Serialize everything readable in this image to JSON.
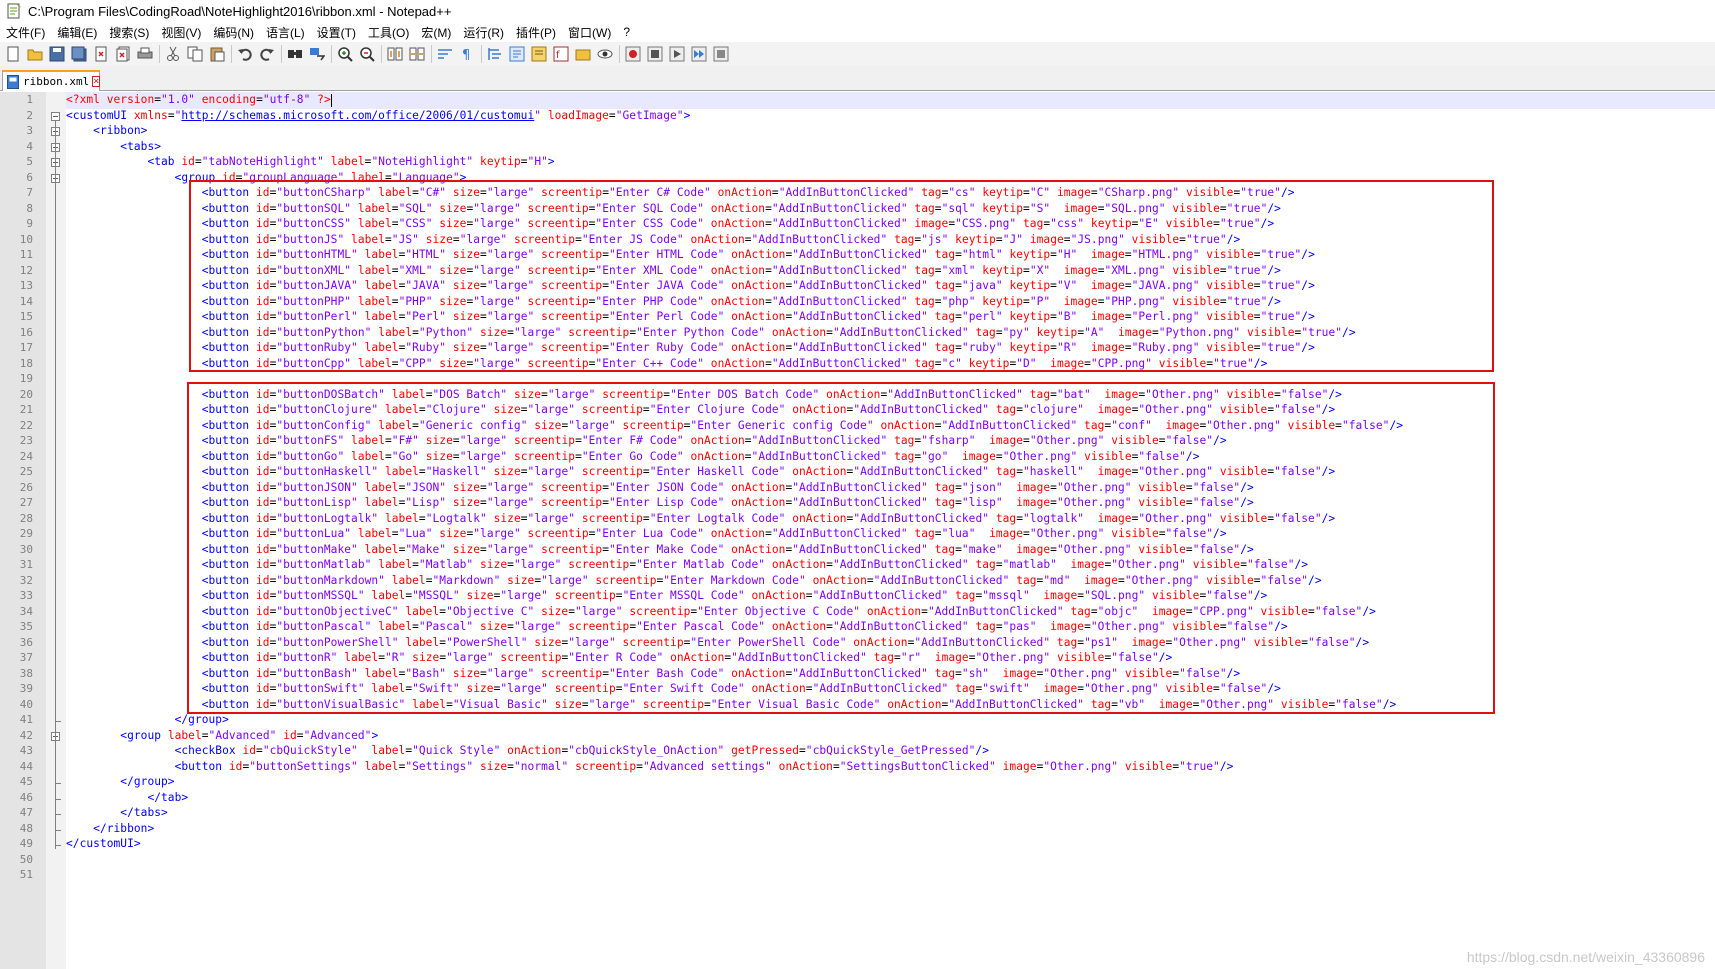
{
  "window": {
    "title": "C:\\Program Files\\CodingRoad\\NoteHighlight2016\\ribbon.xml - Notepad++"
  },
  "menu": [
    "文件(F)",
    "编辑(E)",
    "搜索(S)",
    "视图(V)",
    "编码(N)",
    "语言(L)",
    "设置(T)",
    "工具(O)",
    "宏(M)",
    "运行(R)",
    "插件(P)",
    "窗口(W)",
    "?"
  ],
  "toolbar_icons": [
    "new-file-icon",
    "open-file-icon",
    "save-icon",
    "save-all-icon",
    "close-icon",
    "close-all-icon",
    "print-icon",
    "|",
    "cut-icon",
    "copy-icon",
    "paste-icon",
    "|",
    "undo-icon",
    "redo-icon",
    "|",
    "find-icon",
    "replace-icon",
    "|",
    "zoom-in-icon",
    "zoom-out-icon",
    "|",
    "sync-vertical-icon",
    "sync-horizontal-icon",
    "|",
    "word-wrap-icon",
    "show-all-chars-icon",
    "|",
    "indent-guide-icon",
    "user-lang-icon",
    "doc-map-icon",
    "function-list-icon",
    "folder-workspace-icon",
    "monitor-icon",
    "|",
    "record-macro-icon",
    "stop-record-icon",
    "play-macro-icon",
    "play-multiple-icon",
    "save-macro-icon"
  ],
  "tab": {
    "label": "ribbon.xml"
  },
  "editor": {
    "line_numbers": [
      "1",
      "2",
      "3",
      "4",
      "5",
      "6",
      "7",
      "8",
      "9",
      "10",
      "11",
      "12",
      "13",
      "14",
      "15",
      "16",
      "17",
      "18",
      "19",
      "20",
      "21",
      "22",
      "23",
      "24",
      "25",
      "26",
      "27",
      "28",
      "29",
      "30",
      "31",
      "32",
      "33",
      "34",
      "35",
      "36",
      "37",
      "38",
      "39",
      "40",
      "41",
      "42",
      "43",
      "44",
      "45",
      "46",
      "47",
      "48",
      "49",
      "50",
      "51"
    ],
    "lines": [
      "<?xml version=\"1.0\" encoding=\"utf-8\" ?>",
      "<customUI xmlns=\"http://schemas.microsoft.com/office/2006/01/customui\" loadImage=\"GetImage\">",
      "    <ribbon>",
      "        <tabs>",
      "            <tab id=\"tabNoteHighlight\" label=\"NoteHighlight\" keytip=\"H\">",
      "                <group id=\"groupLanguage\" label=\"Language\">",
      "                    <button id=\"buttonCSharp\" label=\"C#\" size=\"large\" screentip=\"Enter C# Code\" onAction=\"AddInButtonClicked\" tag=\"cs\" keytip=\"C\" image=\"CSharp.png\" visible=\"true\"/>",
      "                    <button id=\"buttonSQL\" label=\"SQL\" size=\"large\" screentip=\"Enter SQL Code\" onAction=\"AddInButtonClicked\" tag=\"sql\" keytip=\"S\"  image=\"SQL.png\" visible=\"true\"/>",
      "                    <button id=\"buttonCSS\" label=\"CSS\" size=\"large\" screentip=\"Enter CSS Code\" onAction=\"AddInButtonClicked\" image=\"CSS.png\" tag=\"css\" keytip=\"E\" visible=\"true\"/>",
      "                    <button id=\"buttonJS\" label=\"JS\" size=\"large\" screentip=\"Enter JS Code\" onAction=\"AddInButtonClicked\" tag=\"js\" keytip=\"J\" image=\"JS.png\" visible=\"true\"/>",
      "                    <button id=\"buttonHTML\" label=\"HTML\" size=\"large\" screentip=\"Enter HTML Code\" onAction=\"AddInButtonClicked\" tag=\"html\" keytip=\"H\"  image=\"HTML.png\" visible=\"true\"/>",
      "                    <button id=\"buttonXML\" label=\"XML\" size=\"large\" screentip=\"Enter XML Code\" onAction=\"AddInButtonClicked\" tag=\"xml\" keytip=\"X\"  image=\"XML.png\" visible=\"true\"/>",
      "                    <button id=\"buttonJAVA\" label=\"JAVA\" size=\"large\" screentip=\"Enter JAVA Code\" onAction=\"AddInButtonClicked\" tag=\"java\" keytip=\"V\"  image=\"JAVA.png\" visible=\"true\"/>",
      "                    <button id=\"buttonPHP\" label=\"PHP\" size=\"large\" screentip=\"Enter PHP Code\" onAction=\"AddInButtonClicked\" tag=\"php\" keytip=\"P\"  image=\"PHP.png\" visible=\"true\"/>",
      "                    <button id=\"buttonPerl\" label=\"Perl\" size=\"large\" screentip=\"Enter Perl Code\" onAction=\"AddInButtonClicked\" tag=\"perl\" keytip=\"B\"  image=\"Perl.png\" visible=\"true\"/>",
      "                    <button id=\"buttonPython\" label=\"Python\" size=\"large\" screentip=\"Enter Python Code\" onAction=\"AddInButtonClicked\" tag=\"py\" keytip=\"A\"  image=\"Python.png\" visible=\"true\"/>",
      "                    <button id=\"buttonRuby\" label=\"Ruby\" size=\"large\" screentip=\"Enter Ruby Code\" onAction=\"AddInButtonClicked\" tag=\"ruby\" keytip=\"R\"  image=\"Ruby.png\" visible=\"true\"/>",
      "                    <button id=\"buttonCpp\" label=\"CPP\" size=\"large\" screentip=\"Enter C++ Code\" onAction=\"AddInButtonClicked\" tag=\"c\" keytip=\"D\"  image=\"CPP.png\" visible=\"true\"/>",
      "",
      "                    <button id=\"buttonDOSBatch\" label=\"DOS Batch\" size=\"large\" screentip=\"Enter DOS Batch Code\" onAction=\"AddInButtonClicked\" tag=\"bat\"  image=\"Other.png\" visible=\"false\"/>",
      "                    <button id=\"buttonClojure\" label=\"Clojure\" size=\"large\" screentip=\"Enter Clojure Code\" onAction=\"AddInButtonClicked\" tag=\"clojure\"  image=\"Other.png\" visible=\"false\"/>",
      "                    <button id=\"buttonConfig\" label=\"Generic config\" size=\"large\" screentip=\"Enter Generic config Code\" onAction=\"AddInButtonClicked\" tag=\"conf\"  image=\"Other.png\" visible=\"false\"/>",
      "                    <button id=\"buttonFS\" label=\"F#\" size=\"large\" screentip=\"Enter F# Code\" onAction=\"AddInButtonClicked\" tag=\"fsharp\"  image=\"Other.png\" visible=\"false\"/>",
      "                    <button id=\"buttonGo\" label=\"Go\" size=\"large\" screentip=\"Enter Go Code\" onAction=\"AddInButtonClicked\" tag=\"go\"  image=\"Other.png\" visible=\"false\"/>",
      "                    <button id=\"buttonHaskell\" label=\"Haskell\" size=\"large\" screentip=\"Enter Haskell Code\" onAction=\"AddInButtonClicked\" tag=\"haskell\"  image=\"Other.png\" visible=\"false\"/>",
      "                    <button id=\"buttonJSON\" label=\"JSON\" size=\"large\" screentip=\"Enter JSON Code\" onAction=\"AddInButtonClicked\" tag=\"json\"  image=\"Other.png\" visible=\"false\"/>",
      "                    <button id=\"buttonLisp\" label=\"Lisp\" size=\"large\" screentip=\"Enter Lisp Code\" onAction=\"AddInButtonClicked\" tag=\"lisp\"  image=\"Other.png\" visible=\"false\"/>",
      "                    <button id=\"buttonLogtalk\" label=\"Logtalk\" size=\"large\" screentip=\"Enter Logtalk Code\" onAction=\"AddInButtonClicked\" tag=\"logtalk\"  image=\"Other.png\" visible=\"false\"/>",
      "                    <button id=\"buttonLua\" label=\"Lua\" size=\"large\" screentip=\"Enter Lua Code\" onAction=\"AddInButtonClicked\" tag=\"lua\"  image=\"Other.png\" visible=\"false\"/>",
      "                    <button id=\"buttonMake\" label=\"Make\" size=\"large\" screentip=\"Enter Make Code\" onAction=\"AddInButtonClicked\" tag=\"make\"  image=\"Other.png\" visible=\"false\"/>",
      "                    <button id=\"buttonMatlab\" label=\"Matlab\" size=\"large\" screentip=\"Enter Matlab Code\" onAction=\"AddInButtonClicked\" tag=\"matlab\"  image=\"Other.png\" visible=\"false\"/>",
      "                    <button id=\"buttonMarkdown\" label=\"Markdown\" size=\"large\" screentip=\"Enter Markdown Code\" onAction=\"AddInButtonClicked\" tag=\"md\"  image=\"Other.png\" visible=\"false\"/>",
      "                    <button id=\"buttonMSSQL\" label=\"MSSQL\" size=\"large\" screentip=\"Enter MSSQL Code\" onAction=\"AddInButtonClicked\" tag=\"mssql\"  image=\"SQL.png\" visible=\"false\"/>",
      "                    <button id=\"buttonObjectiveC\" label=\"Objective C\" size=\"large\" screentip=\"Enter Objective C Code\" onAction=\"AddInButtonClicked\" tag=\"objc\"  image=\"CPP.png\" visible=\"false\"/>",
      "                    <button id=\"buttonPascal\" label=\"Pascal\" size=\"large\" screentip=\"Enter Pascal Code\" onAction=\"AddInButtonClicked\" tag=\"pas\"  image=\"Other.png\" visible=\"false\"/>",
      "                    <button id=\"buttonPowerShell\" label=\"PowerShell\" size=\"large\" screentip=\"Enter PowerShell Code\" onAction=\"AddInButtonClicked\" tag=\"ps1\"  image=\"Other.png\" visible=\"false\"/>",
      "                    <button id=\"buttonR\" label=\"R\" size=\"large\" screentip=\"Enter R Code\" onAction=\"AddInButtonClicked\" tag=\"r\"  image=\"Other.png\" visible=\"false\"/>",
      "                    <button id=\"buttonBash\" label=\"Bash\" size=\"large\" screentip=\"Enter Bash Code\" onAction=\"AddInButtonClicked\" tag=\"sh\"  image=\"Other.png\" visible=\"false\"/>",
      "                    <button id=\"buttonSwift\" label=\"Swift\" size=\"large\" screentip=\"Enter Swift Code\" onAction=\"AddInButtonClicked\" tag=\"swift\"  image=\"Other.png\" visible=\"false\"/>",
      "                    <button id=\"buttonVisualBasic\" label=\"Visual Basic\" size=\"large\" screentip=\"Enter Visual Basic Code\" onAction=\"AddInButtonClicked\" tag=\"vb\"  image=\"Other.png\" visible=\"false\"/>",
      "                </group>",
      "        <group label=\"Advanced\" id=\"Advanced\">",
      "                <checkBox id=\"cbQuickStyle\"  label=\"Quick Style\" onAction=\"cbQuickStyle_OnAction\" getPressed=\"cbQuickStyle_GetPressed\"/>",
      "                <button id=\"buttonSettings\" label=\"Settings\" size=\"normal\" screentip=\"Advanced settings\" onAction=\"SettingsButtonClicked\" image=\"Other.png\" visible=\"true\"/>",
      "        </group>",
      "            </tab>",
      "        </tabs>",
      "    </ribbon>",
      "</customUI>",
      "",
      ""
    ]
  },
  "watermark": "https://blog.csdn.net/weixin_43360896",
  "colors": {
    "tag": "#0000ff",
    "attribute": "#ff0000",
    "value": "#8000ff",
    "highlight_box": "#e01010",
    "current_line": "#e8e8ff"
  }
}
